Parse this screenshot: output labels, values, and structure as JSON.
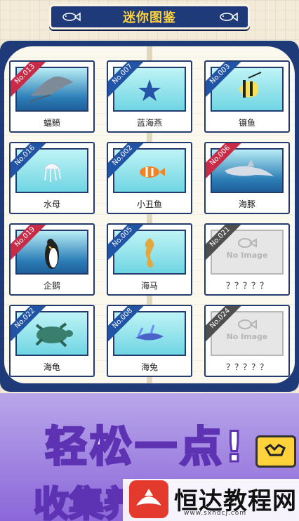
{
  "header": {
    "title": "迷你图鉴"
  },
  "cards": [
    {
      "number": "No.013",
      "name": "蝠鲼",
      "ribbon": "red",
      "bg": "deep",
      "icon": "manta-ray-icon"
    },
    {
      "number": "No.007",
      "name": "蓝海燕",
      "ribbon": "blue",
      "bg": "light",
      "icon": "starfish-icon"
    },
    {
      "number": "No.003",
      "name": "镰鱼",
      "ribbon": "blue",
      "bg": "light",
      "icon": "moorish-idol-icon"
    },
    {
      "number": "No.016",
      "name": "水母",
      "ribbon": "blue",
      "bg": "light",
      "icon": "jellyfish-icon"
    },
    {
      "number": "No.002",
      "name": "小丑鱼",
      "ribbon": "blue",
      "bg": "light",
      "icon": "clownfish-icon"
    },
    {
      "number": "No.006",
      "name": "海豚",
      "ribbon": "red",
      "bg": "deep",
      "icon": "dolphin-icon"
    },
    {
      "number": "No.019",
      "name": "企鹅",
      "ribbon": "red",
      "bg": "deep",
      "icon": "penguin-icon"
    },
    {
      "number": "No.005",
      "name": "海马",
      "ribbon": "blue",
      "bg": "light",
      "icon": "seahorse-icon"
    },
    {
      "number": "No.021",
      "name": "？？？？？",
      "ribbon": "gray",
      "bg": "gray",
      "icon": "no-image-icon",
      "placeholder": "No Image"
    },
    {
      "number": "No.022",
      "name": "海龟",
      "ribbon": "blue",
      "bg": "light",
      "icon": "turtle-icon"
    },
    {
      "number": "No.008",
      "name": "海兔",
      "ribbon": "blue",
      "bg": "light",
      "icon": "sea-slug-icon"
    },
    {
      "number": "No.024",
      "name": "？？？？？",
      "ribbon": "gray",
      "bg": "gray",
      "icon": "no-image-icon",
      "placeholder": "No Image"
    }
  ],
  "promo": {
    "line1": "轻松一点!",
    "line2": "收集养"
  },
  "watermark": {
    "title": "恒达教程网",
    "url": "www.sxhdcj.com"
  },
  "colors": {
    "navy": "#1f3a78",
    "gold": "#ffd23c",
    "red_ribbon": "#c92b46",
    "blue_ribbon": "#2254a6",
    "purple": "#8b67d9"
  }
}
